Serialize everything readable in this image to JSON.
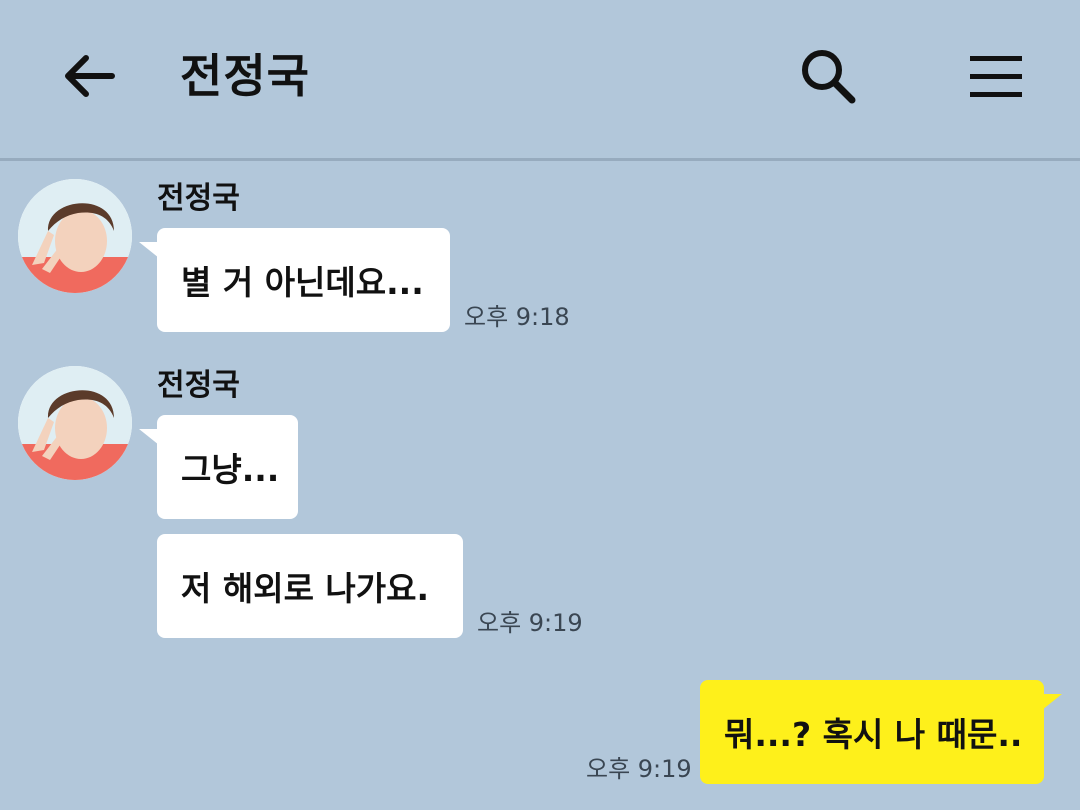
{
  "header": {
    "title": "전정국",
    "back_icon": "back-arrow-icon",
    "search_icon": "search-icon",
    "menu_icon": "hamburger-menu-icon"
  },
  "colors": {
    "background": "#b2c7da",
    "received_bubble": "#ffffff",
    "sent_bubble": "#fef01b"
  },
  "messages": [
    {
      "sender": "전정국",
      "bubbles": [
        "별 거 아닌데요..."
      ],
      "time": "오후 9:18"
    },
    {
      "sender": "전정국",
      "bubbles": [
        "그냥...",
        "저 해외로 나가요."
      ],
      "time": "오후 9:19"
    },
    {
      "sender": "me",
      "bubbles": [
        "뭐...? 혹시 나 때문.."
      ],
      "time": "오후 9:19"
    }
  ]
}
